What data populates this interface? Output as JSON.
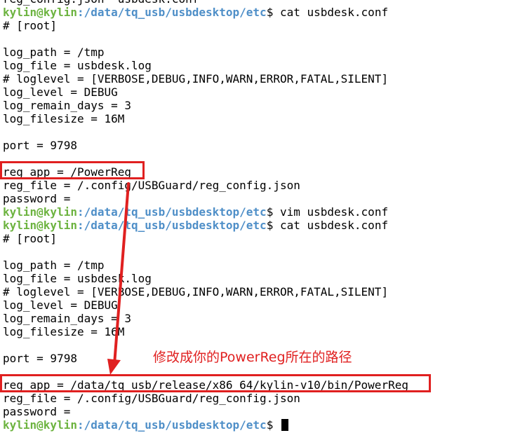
{
  "terminal": {
    "lines": [
      {
        "type": "text",
        "text": "reg_config.json  usbdesk.conf"
      },
      {
        "type": "prompt",
        "user": "kylin@kylin",
        "path": ":/data/tq_usb/usbdesktop/etc",
        "symbol": "$ ",
        "command": "cat usbdesk.conf"
      },
      {
        "type": "text",
        "text": "# [root]"
      },
      {
        "type": "text",
        "text": ""
      },
      {
        "type": "text",
        "text": "log_path = /tmp"
      },
      {
        "type": "text",
        "text": "log_file = usbdesk.log"
      },
      {
        "type": "text",
        "text": "# loglevel = [VERBOSE,DEBUG,INFO,WARN,ERROR,FATAL,SILENT]"
      },
      {
        "type": "text",
        "text": "log_level = DEBUG"
      },
      {
        "type": "text",
        "text": "log_remain_days = 3"
      },
      {
        "type": "text",
        "text": "log_filesize = 16M"
      },
      {
        "type": "text",
        "text": ""
      },
      {
        "type": "text",
        "text": "port = 9798"
      },
      {
        "type": "text",
        "text": ""
      },
      {
        "type": "text",
        "text": "reg_app = /PowerReg"
      },
      {
        "type": "text",
        "text": "reg_file = /.config/USBGuard/reg_config.json"
      },
      {
        "type": "text",
        "text": "password ="
      },
      {
        "type": "prompt",
        "user": "kylin@kylin",
        "path": ":/data/tq_usb/usbdesktop/etc",
        "symbol": "$ ",
        "command": "vim usbdesk.conf"
      },
      {
        "type": "prompt",
        "user": "kylin@kylin",
        "path": ":/data/tq_usb/usbdesktop/etc",
        "symbol": "$ ",
        "command": "cat usbdesk.conf"
      },
      {
        "type": "text",
        "text": "# [root]"
      },
      {
        "type": "text",
        "text": ""
      },
      {
        "type": "text",
        "text": "log_path = /tmp"
      },
      {
        "type": "text",
        "text": "log_file = usbdesk.log"
      },
      {
        "type": "text",
        "text": "# loglevel = [VERBOSE,DEBUG,INFO,WARN,ERROR,FATAL,SILENT]"
      },
      {
        "type": "text",
        "text": "log_level = DEBUG"
      },
      {
        "type": "text",
        "text": "log_remain_days = 3"
      },
      {
        "type": "text",
        "text": "log_filesize = 16M"
      },
      {
        "type": "text",
        "text": ""
      },
      {
        "type": "text",
        "text": "port = 9798"
      },
      {
        "type": "text",
        "text": ""
      },
      {
        "type": "text",
        "text": "reg_app = /data/tq_usb/release/x86_64/kylin-v10/bin/PowerReg"
      },
      {
        "type": "text",
        "text": "reg_file = /.config/USBGuard/reg_config.json"
      },
      {
        "type": "text",
        "text": "password ="
      },
      {
        "type": "prompt",
        "user": "kylin@kylin",
        "path": ":/data/tq_usb/usbdesktop/etc",
        "symbol": "$ ",
        "command": "",
        "cursor": true
      }
    ]
  },
  "annotation": {
    "text": "修改成你的PowerReg所在的路径",
    "color": "#e02020"
  },
  "colors": {
    "prompt_user": "#6cb33f",
    "prompt_path": "#4f8fc8",
    "highlight": "#e02020",
    "background": "#ffffff",
    "text": "#000000"
  }
}
